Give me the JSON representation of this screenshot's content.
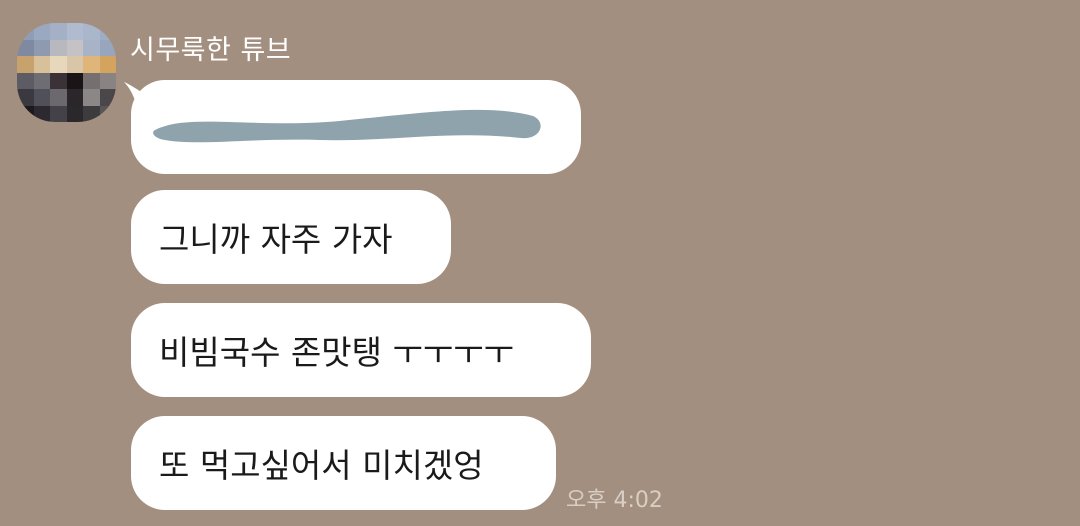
{
  "chat": {
    "sender_name": "시무룩한 튜브",
    "avatar_icon": "pixelated-profile-photo",
    "messages": [
      {
        "text": "",
        "redacted": true
      },
      {
        "text": "그니까 자주 가자"
      },
      {
        "text": "비빔국수 존맛탱 ㅜㅜㅜㅜ"
      },
      {
        "text": "또 먹고싶어서 미치겠엉"
      }
    ],
    "timestamp": "오후 4:02"
  },
  "colors": {
    "background": "#a38f7f",
    "bubble": "#ffffff",
    "redaction": "#8fa3ac"
  }
}
